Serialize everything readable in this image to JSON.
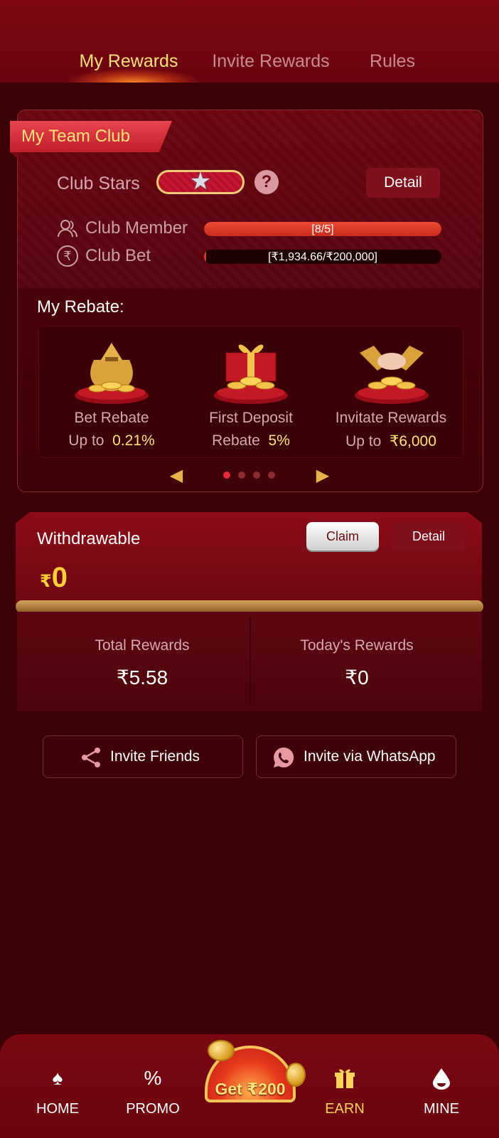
{
  "tabs": [
    {
      "label": "My Rewards",
      "active": true
    },
    {
      "label": "Invite Rewards",
      "active": false
    },
    {
      "label": "Rules",
      "active": false
    }
  ],
  "team_club": {
    "title": "My Team Club",
    "club_stars_label": "Club Stars",
    "stars": 1,
    "detail_label": "Detail",
    "member_label": "Club Member",
    "member_value": "[8/5]",
    "member_progress": 1.0,
    "bet_label": "Club Bet",
    "bet_value": "[₹1,934.66/₹200,000]",
    "bet_progress": 0.0097
  },
  "rebate": {
    "title": "My Rebate:",
    "items": [
      {
        "name": "Bet Rebate",
        "prefix": "Up to",
        "value": "0.21%",
        "icon": "money-bag-icon"
      },
      {
        "name": "First Deposit",
        "prefix": "Rebate",
        "value": "5%",
        "icon": "gift-box-coins-icon"
      },
      {
        "name": "Invitate Rewards",
        "prefix": "Up to",
        "value": "₹6,000",
        "icon": "handshake-coins-icon"
      }
    ],
    "page_count": 4,
    "current_page": 1
  },
  "withdrawable": {
    "label": "Withdrawable",
    "currency": "₹",
    "amount": "0",
    "claim_label": "Claim",
    "detail_label": "Detail"
  },
  "rewards": {
    "total_label": "Total Rewards",
    "total_value": "₹5.58",
    "today_label": "Today's Rewards",
    "today_value": "₹0"
  },
  "invite": {
    "friends_label": "Invite Friends",
    "whatsapp_label": "Invite via WhatsApp"
  },
  "nav": {
    "items": [
      {
        "label": "HOME",
        "icon": "spade-icon"
      },
      {
        "label": "PROMO",
        "icon": "coupon-icon"
      },
      {
        "label": "EARN",
        "icon": "gift-icon",
        "active": true
      },
      {
        "label": "MINE",
        "icon": "drop-icon"
      }
    ],
    "center_label": "Get ₹200"
  },
  "colors": {
    "accent_gold": "#ffe27a",
    "background": "#3a0006",
    "primary_red": "#82101c"
  }
}
